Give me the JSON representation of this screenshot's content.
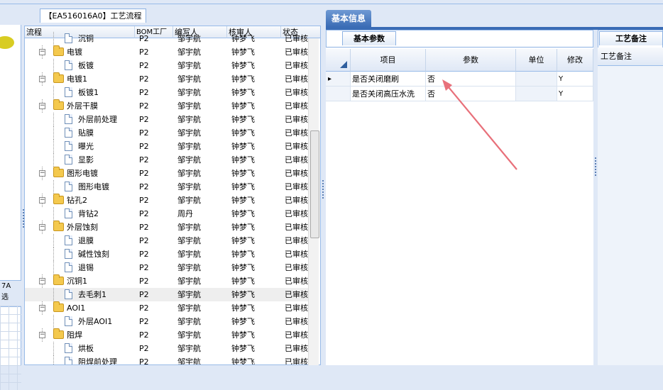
{
  "tree_panel": {
    "title": "【EA516016A0】工艺流程",
    "columns": [
      "流程",
      "BOM工厂",
      "编写人",
      "核审人",
      "状态"
    ],
    "rows": [
      {
        "level": 2,
        "type": "doc",
        "name": "沉铜",
        "bom": "P2",
        "writer": "邹宇航",
        "reviewer": "钟梦飞",
        "status": "已审核"
      },
      {
        "level": 1,
        "type": "folder",
        "name": "电镀",
        "bom": "P2",
        "writer": "邹宇航",
        "reviewer": "钟梦飞",
        "status": "已审核"
      },
      {
        "level": 2,
        "type": "doc",
        "name": "板镀",
        "bom": "P2",
        "writer": "邹宇航",
        "reviewer": "钟梦飞",
        "status": "已审核"
      },
      {
        "level": 1,
        "type": "folder",
        "name": "电镀1",
        "bom": "P2",
        "writer": "邹宇航",
        "reviewer": "钟梦飞",
        "status": "已审核"
      },
      {
        "level": 2,
        "type": "doc",
        "name": "板镀1",
        "bom": "P2",
        "writer": "邹宇航",
        "reviewer": "钟梦飞",
        "status": "已审核"
      },
      {
        "level": 1,
        "type": "folder",
        "name": "外层干膜",
        "bom": "P2",
        "writer": "邹宇航",
        "reviewer": "钟梦飞",
        "status": "已审核"
      },
      {
        "level": 2,
        "type": "doc",
        "name": "外层前处理",
        "bom": "P2",
        "writer": "邹宇航",
        "reviewer": "钟梦飞",
        "status": "已审核"
      },
      {
        "level": 2,
        "type": "doc",
        "name": "贴膜",
        "bom": "P2",
        "writer": "邹宇航",
        "reviewer": "钟梦飞",
        "status": "已审核"
      },
      {
        "level": 2,
        "type": "doc",
        "name": "曝光",
        "bom": "P2",
        "writer": "邹宇航",
        "reviewer": "钟梦飞",
        "status": "已审核"
      },
      {
        "level": 2,
        "type": "doc",
        "name": "显影",
        "bom": "P2",
        "writer": "邹宇航",
        "reviewer": "钟梦飞",
        "status": "已审核"
      },
      {
        "level": 1,
        "type": "folder",
        "name": "图形电镀",
        "bom": "P2",
        "writer": "邹宇航",
        "reviewer": "钟梦飞",
        "status": "已审核"
      },
      {
        "level": 2,
        "type": "doc",
        "name": "图形电镀",
        "bom": "P2",
        "writer": "邹宇航",
        "reviewer": "钟梦飞",
        "status": "已审核"
      },
      {
        "level": 1,
        "type": "folder",
        "name": "钻孔2",
        "bom": "P2",
        "writer": "邹宇航",
        "reviewer": "钟梦飞",
        "status": "已审核"
      },
      {
        "level": 2,
        "type": "doc",
        "name": "背钻2",
        "bom": "P2",
        "writer": "周丹",
        "reviewer": "钟梦飞",
        "status": "已审核"
      },
      {
        "level": 1,
        "type": "folder",
        "name": "外层蚀刻",
        "bom": "P2",
        "writer": "邹宇航",
        "reviewer": "钟梦飞",
        "status": "已审核"
      },
      {
        "level": 2,
        "type": "doc",
        "name": "退膜",
        "bom": "P2",
        "writer": "邹宇航",
        "reviewer": "钟梦飞",
        "status": "已审核"
      },
      {
        "level": 2,
        "type": "doc",
        "name": "碱性蚀刻",
        "bom": "P2",
        "writer": "邹宇航",
        "reviewer": "钟梦飞",
        "status": "已审核"
      },
      {
        "level": 2,
        "type": "doc",
        "name": "退锡",
        "bom": "P2",
        "writer": "邹宇航",
        "reviewer": "钟梦飞",
        "status": "已审核"
      },
      {
        "level": 1,
        "type": "folder",
        "name": "沉铜1",
        "bom": "P2",
        "writer": "邹宇航",
        "reviewer": "钟梦飞",
        "status": "已审核"
      },
      {
        "level": 2,
        "type": "doc",
        "name": "去毛刺1",
        "bom": "P2",
        "writer": "邹宇航",
        "reviewer": "钟梦飞",
        "status": "已审核",
        "selected": true
      },
      {
        "level": 1,
        "type": "folder",
        "name": "AOI1",
        "bom": "P2",
        "writer": "邹宇航",
        "reviewer": "钟梦飞",
        "status": "已审核"
      },
      {
        "level": 2,
        "type": "doc",
        "name": "外层AOI1",
        "bom": "P2",
        "writer": "邹宇航",
        "reviewer": "钟梦飞",
        "status": "已审核"
      },
      {
        "level": 1,
        "type": "folder",
        "name": "阻焊",
        "bom": "P2",
        "writer": "邹宇航",
        "reviewer": "钟梦飞",
        "status": "已审核"
      },
      {
        "level": 2,
        "type": "doc",
        "name": "烘板",
        "bom": "P2",
        "writer": "邹宇航",
        "reviewer": "钟梦飞",
        "status": "已审核"
      },
      {
        "level": 2,
        "type": "doc",
        "name": "阻焊前处理",
        "bom": "P2",
        "writer": "邹宇航",
        "reviewer": "钟梦飞",
        "status": "已审核"
      }
    ]
  },
  "left_panel": {
    "bar_text_1": "7A",
    "bar_text_2": "选"
  },
  "right": {
    "main_tab": "基本信息",
    "params_tab": "基本参数",
    "columns": [
      "项目",
      "参数",
      "单位",
      "修改"
    ],
    "rows": [
      {
        "item": "是否关闭磨刷",
        "param": "否",
        "unit": "",
        "modify": "Y",
        "current": true
      },
      {
        "item": "是否关闭高压水洗",
        "param": "否",
        "unit": "",
        "modify": "Y",
        "current": false
      }
    ],
    "remark_tab": "工艺备注",
    "remark_header": "工艺备注"
  },
  "colors": {
    "accent": "#3a6cb5",
    "arrow": "#e8707a",
    "panel_border": "#99bbe8"
  }
}
